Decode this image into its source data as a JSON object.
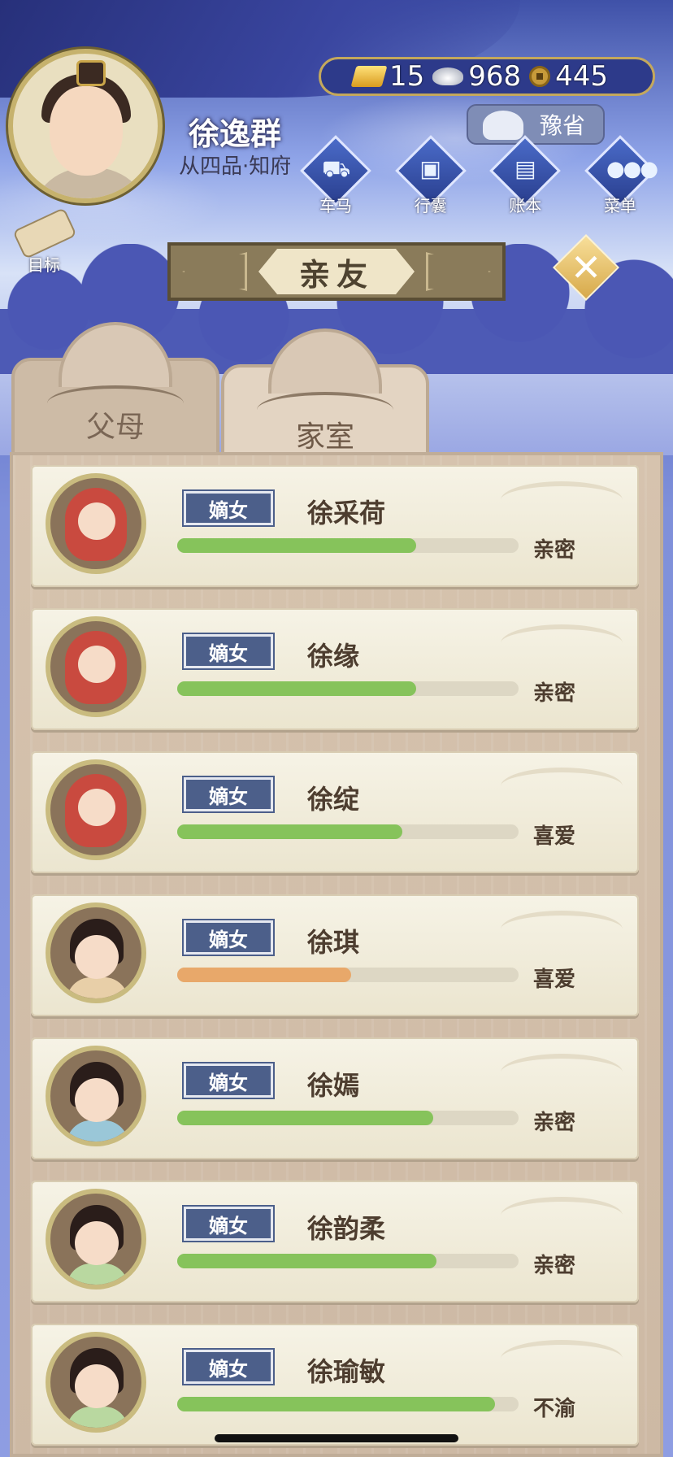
{
  "player": {
    "name": "徐逸群",
    "rank": "从四品·知府"
  },
  "currency": {
    "gold": "15",
    "silver": "968",
    "coins": "445"
  },
  "region": "豫省",
  "top_nav": [
    {
      "label": "车马",
      "icon": "carriage-icon"
    },
    {
      "label": "行囊",
      "icon": "bundle-icon"
    },
    {
      "label": "账本",
      "icon": "ledger-icon"
    },
    {
      "label": "菜单",
      "icon": "menu-dots-icon"
    }
  ],
  "goal_label": "目标",
  "title": "亲友",
  "tabs": [
    {
      "label": "父母",
      "active": false
    },
    {
      "label": "家室",
      "active": true
    }
  ],
  "family": [
    {
      "role": "嫡女",
      "name": "徐采荷",
      "status": "亲密",
      "affinity": 0.7,
      "bar_color": "#86c35b",
      "portrait": "baby"
    },
    {
      "role": "嫡女",
      "name": "徐缘",
      "status": "亲密",
      "affinity": 0.7,
      "bar_color": "#86c35b",
      "portrait": "baby"
    },
    {
      "role": "嫡女",
      "name": "徐绽",
      "status": "喜爱",
      "affinity": 0.66,
      "bar_color": "#86c35b",
      "portrait": "baby"
    },
    {
      "role": "嫡女",
      "name": "徐琪",
      "status": "喜爱",
      "affinity": 0.51,
      "bar_color": "#e8a86a",
      "portrait": "girl-purple"
    },
    {
      "role": "嫡女",
      "name": "徐嫣",
      "status": "亲密",
      "affinity": 0.75,
      "bar_color": "#86c35b",
      "portrait": "girl-red"
    },
    {
      "role": "嫡女",
      "name": "徐韵柔",
      "status": "亲密",
      "affinity": 0.76,
      "bar_color": "#86c35b",
      "portrait": "girl-blue"
    },
    {
      "role": "嫡女",
      "name": "徐瑜敏",
      "status": "不渝",
      "affinity": 0.93,
      "bar_color": "#86c35b",
      "portrait": "girl-blue"
    }
  ]
}
